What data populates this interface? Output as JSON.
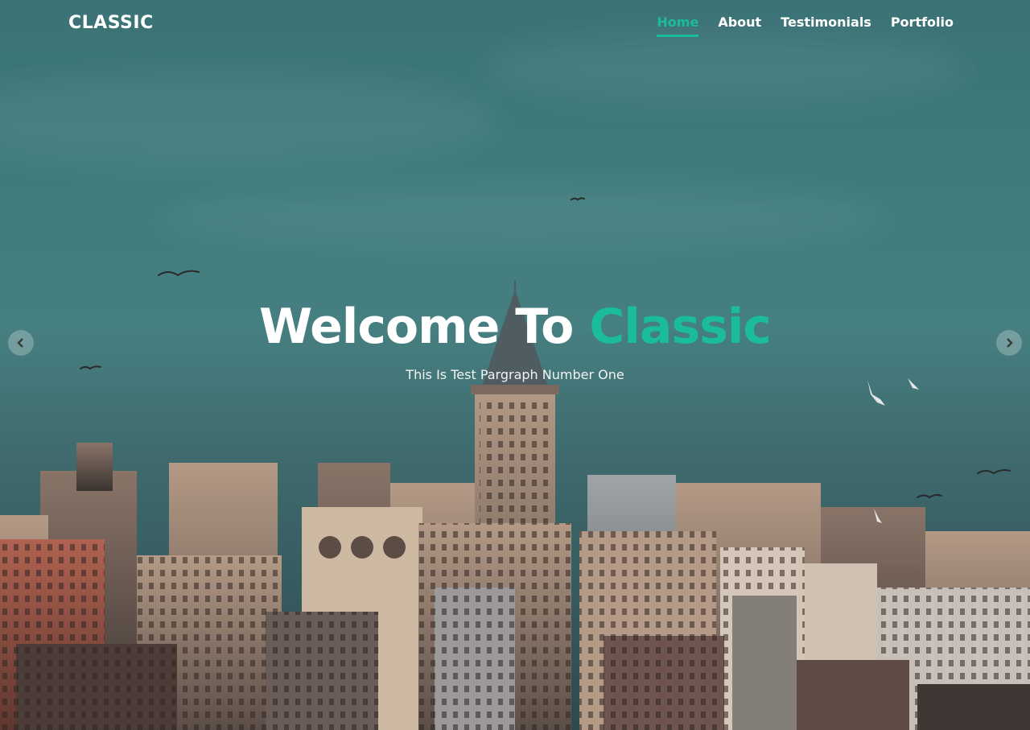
{
  "brand": {
    "logo": "CLASSIC",
    "accent_color": "#1abc9c"
  },
  "nav": {
    "items": [
      {
        "label": "Home",
        "active": true
      },
      {
        "label": "About",
        "active": false
      },
      {
        "label": "Testimonials",
        "active": false
      },
      {
        "label": "Portfolio",
        "active": false
      }
    ]
  },
  "hero": {
    "title_main": "Welcome To",
    "title_accent": "Classic",
    "subtitle": "This Is Test Pargraph Number One",
    "background_description_icon": "city-skyline-image"
  },
  "slider": {
    "prev_icon": "chevron-left-icon",
    "next_icon": "chevron-right-icon"
  }
}
